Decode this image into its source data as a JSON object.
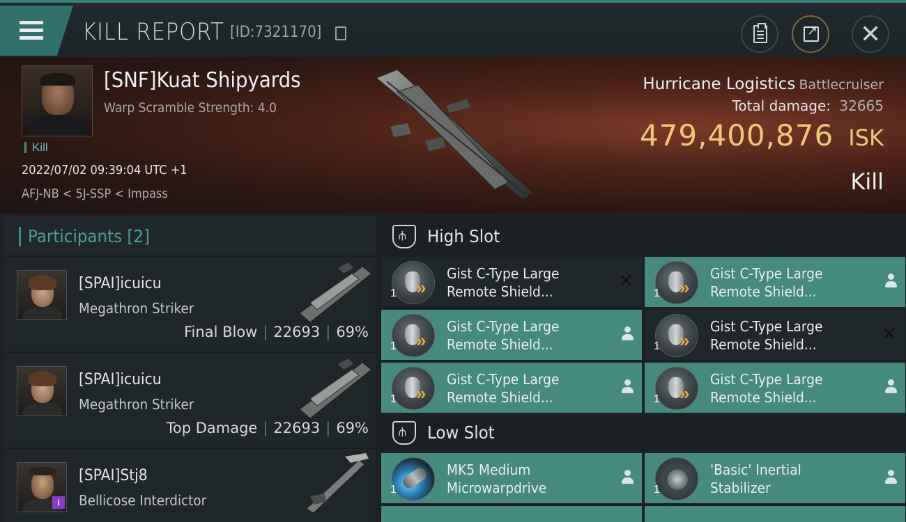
{
  "header": {
    "title": "KILL REPORT",
    "kill_id": "[ID:7321170]",
    "icons": [
      "menu-icon",
      "copy-icon",
      "clipboard-icon",
      "share-icon",
      "close-icon"
    ]
  },
  "victim": {
    "name": "[SNF]Kuat Shipyards",
    "subtitle": "Warp Scramble Strength: 4.0",
    "tag": "Kill",
    "time": "2022/07/02 09:39:04 UTC +1",
    "location": "AFJ-NB < 5J-SSP < Impass",
    "ship_name": "Hurricane Logistics",
    "ship_class": "Battlecruiser",
    "damage_label": "Total damage:",
    "damage_value": "32665",
    "isk_amount": "479,400,876",
    "isk_currency": "ISK",
    "kill_type": "Kill"
  },
  "participants": {
    "label": "Participants",
    "count": "[2]",
    "rows": [
      {
        "name": "[SPAI]icuicu",
        "ship": "Megathron Striker",
        "role": "Final Blow",
        "damage": "22693",
        "percent": "69%"
      },
      {
        "name": "[SPAI]icuicu",
        "ship": "Megathron Striker",
        "role": "Top Damage",
        "damage": "22693",
        "percent": "69%"
      },
      {
        "name": "[SPAI]Stj8",
        "ship": "Bellicose Interdictor",
        "badge": "i"
      }
    ]
  },
  "high_slot": {
    "label": "High Slot",
    "modules": [
      {
        "line1": "Gist C-Type Large",
        "line2": "Remote Shield...",
        "qty": "1",
        "state": "destroyed"
      },
      {
        "line1": "Gist C-Type Large",
        "line2": "Remote Shield...",
        "qty": "1",
        "state": "dropped"
      },
      {
        "line1": "Gist C-Type Large",
        "line2": "Remote Shield...",
        "qty": "1",
        "state": "dropped"
      },
      {
        "line1": "Gist C-Type Large",
        "line2": "Remote Shield...",
        "qty": "1",
        "state": "destroyed"
      },
      {
        "line1": "Gist C-Type Large",
        "line2": "Remote Shield...",
        "qty": "1",
        "state": "dropped"
      },
      {
        "line1": "Gist C-Type Large",
        "line2": "Remote Shield...",
        "qty": "1",
        "state": "dropped"
      }
    ]
  },
  "low_slot": {
    "label": "Low Slot",
    "modules": [
      {
        "line1": "MK5 Medium",
        "line2": "Microwarpdrive",
        "qty": "1",
        "state": "dropped"
      },
      {
        "line1": "'Basic' Inertial",
        "line2": "Stabilizer",
        "qty": "1",
        "state": "dropped"
      }
    ]
  },
  "colors": {
    "accent": "#3f8f87",
    "dropped_bg": "#45897f",
    "destroyed_bg": "#1f272a",
    "isk": "#f0c77a"
  }
}
